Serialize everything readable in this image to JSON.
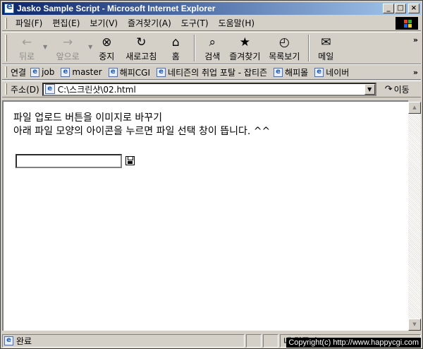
{
  "window": {
    "title": "Jasko Sample Script - Microsoft Internet Explorer",
    "controls": {
      "minimize": "_",
      "maximize": "□",
      "close": "×"
    }
  },
  "menu": {
    "items": [
      "파일(F)",
      "편집(E)",
      "보기(V)",
      "즐겨찾기(A)",
      "도구(T)",
      "도움말(H)"
    ]
  },
  "toolbar": {
    "back": {
      "label": "뒤로",
      "icon": "back-arrow-icon"
    },
    "forward": {
      "label": "앞으로",
      "icon": "forward-arrow-icon"
    },
    "stop": {
      "label": "중지",
      "icon": "stop-icon"
    },
    "refresh": {
      "label": "새로고침",
      "icon": "refresh-icon"
    },
    "home": {
      "label": "홈",
      "icon": "home-icon"
    },
    "search": {
      "label": "검색",
      "icon": "search-icon"
    },
    "favorites": {
      "label": "즐겨찾기",
      "icon": "favorites-icon"
    },
    "history": {
      "label": "목록보기",
      "icon": "history-icon"
    },
    "mail": {
      "label": "메일",
      "icon": "mail-icon"
    }
  },
  "links": {
    "label": "연결",
    "items": [
      "job",
      "master",
      "해피CGI",
      "네티즌의 취업 포탈 - 잡티즌",
      "해피몰",
      "네이버"
    ]
  },
  "address": {
    "label": "주소(D)",
    "url": "C:\\스크린샷\\02.html",
    "go_label": "이동"
  },
  "content": {
    "line1": "파일 업로드 버튼을 이미지로 바꾸기",
    "line2": "아래 파일 모양의 아이콘을 누르면 파일 선택 창이 뜹니다. ^^",
    "file_input_value": ""
  },
  "status": {
    "text": "완료",
    "zone": "내 컴퓨터"
  },
  "watermark": "Copyright(c) http://www.happycgi.com"
}
